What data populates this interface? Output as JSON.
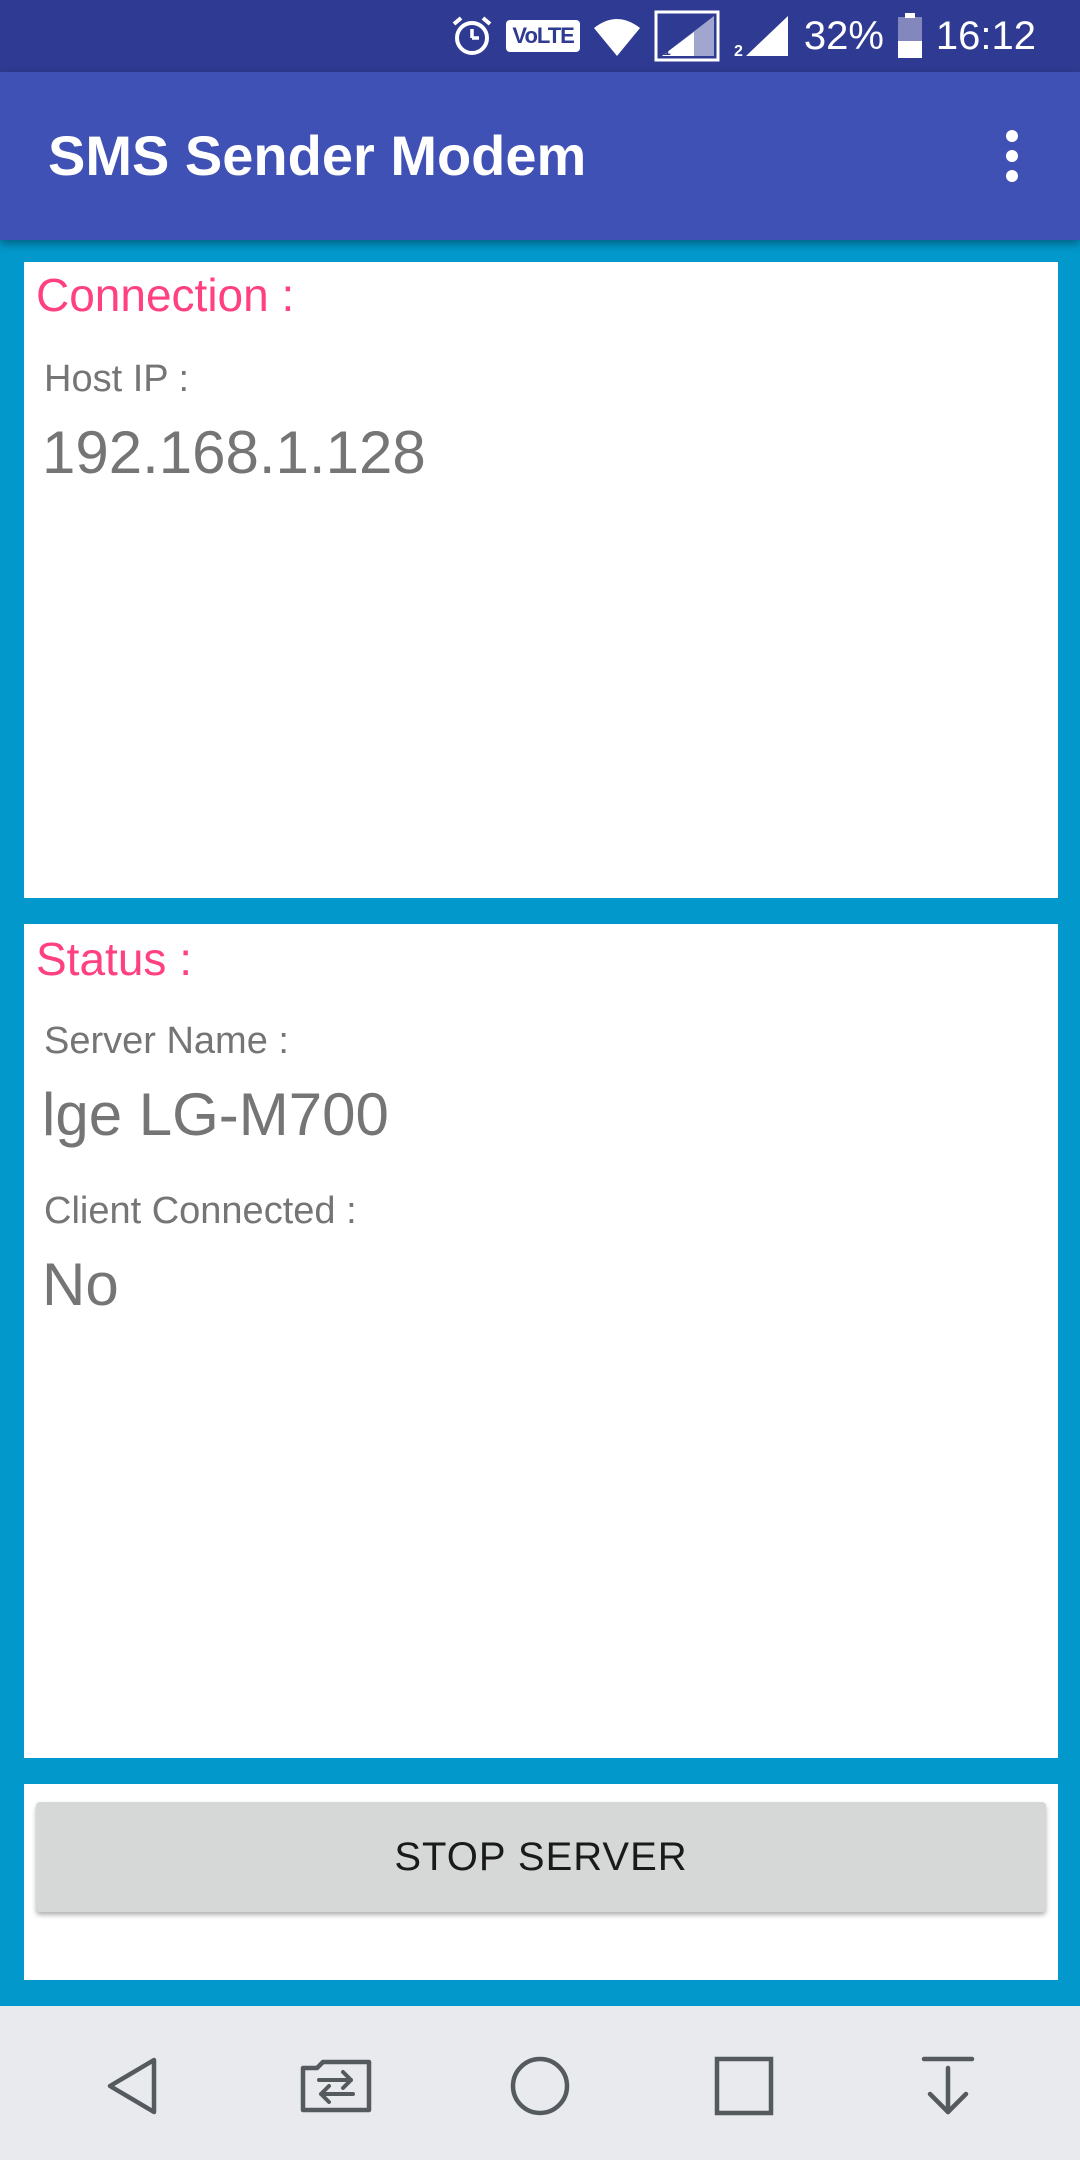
{
  "status_bar": {
    "volte": "VoLTE",
    "battery_percent": "32%",
    "time": "16:12",
    "icons": [
      "alarm-icon",
      "volte-icon",
      "wifi-icon",
      "sim1-signal-icon",
      "sim2-signal-icon",
      "battery-icon"
    ]
  },
  "app_bar": {
    "title": "SMS Sender Modem",
    "menu_icon": "overflow-menu-icon"
  },
  "connection": {
    "title": "Connection :",
    "host_ip_label": "Host IP :",
    "host_ip_value": "192.168.1.128"
  },
  "status": {
    "title": "Status :",
    "server_name_label": "Server Name :",
    "server_name_value": "lge LG-M700",
    "client_connected_label": "Client Connected :",
    "client_connected_value": "No"
  },
  "actions": {
    "stop_server_label": "STOP SERVER"
  },
  "nav_bar": {
    "icons": [
      "back-icon",
      "switch-sim-icon",
      "home-icon",
      "recents-icon",
      "notification-pull-icon"
    ]
  },
  "colors": {
    "status_bar": "#2f3a92",
    "app_bar": "#3f51b5",
    "background": "#0298cb",
    "section_title": "#ff4081",
    "text_secondary": "#757575",
    "button": "#d6d7d7",
    "nav_bar": "#e8eaed"
  }
}
